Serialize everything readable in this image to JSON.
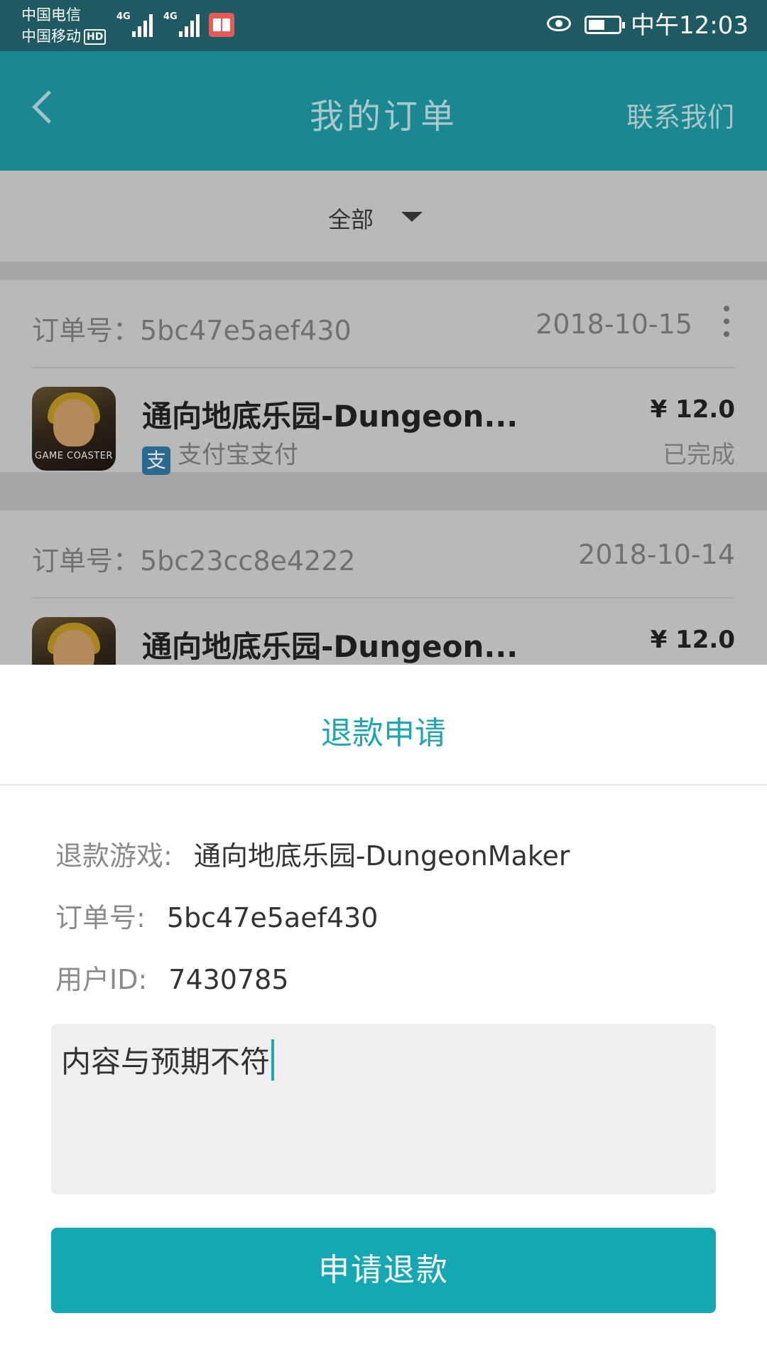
{
  "status_bar": {
    "carrier_1": "中国电信",
    "carrier_2": "中国移动",
    "hd_badge": "HD",
    "network_1": "4G",
    "network_2": "4G",
    "time": "中午12:03"
  },
  "app_bar": {
    "title": "我的订单",
    "contact_label": "联系我们"
  },
  "filter": {
    "selected": "全部"
  },
  "orders": [
    {
      "order_no": "订单号：5bc47e5aef430",
      "date": "2018-10-15",
      "game_name": "通向地底乐园-Dungeon...",
      "icon_caption": "GAME COASTER",
      "price": "¥ 12.0",
      "payment": "支付宝支付",
      "payment_icon_glyph": "支",
      "status": "已完成"
    },
    {
      "order_no": "订单号：5bc23cc8e4222",
      "date": "2018-10-14",
      "game_name": "通向地底乐园-Dungeon...",
      "price": "¥ 12.0"
    }
  ],
  "refund": {
    "title": "退款申请",
    "game_label": "退款游戏:",
    "game_value": "通向地底乐园-DungeonMaker",
    "order_label": "订单号:",
    "order_value": "5bc47e5aef430",
    "user_label": "用户ID:",
    "user_value": "7430785",
    "reason_text": "内容与预期不符",
    "submit_label": "申请退款"
  },
  "colors": {
    "accent": "#14a8b4",
    "appbar": "#1a8791"
  }
}
